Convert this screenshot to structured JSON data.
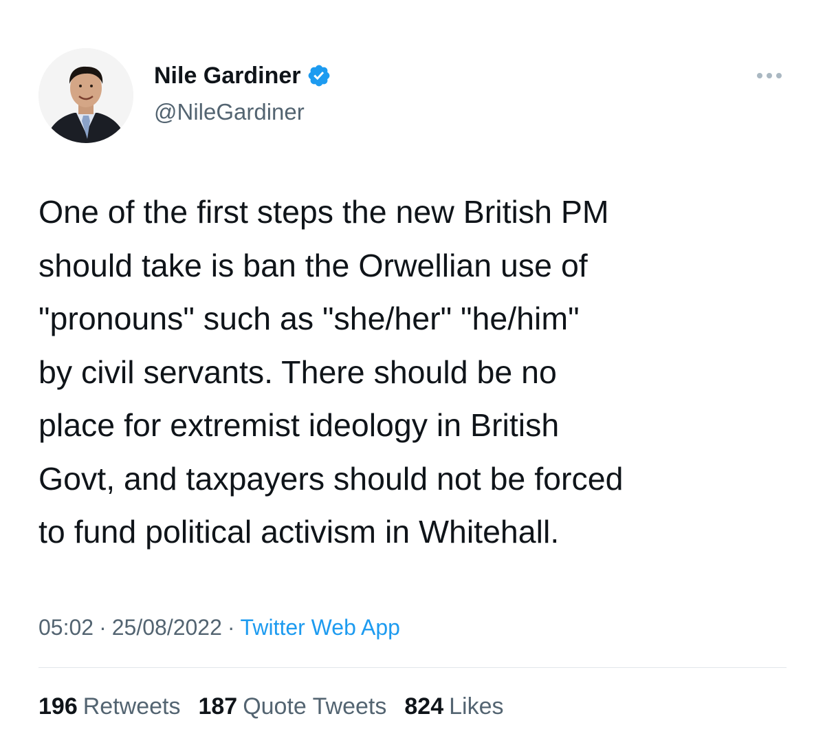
{
  "author": {
    "display_name": "Nile Gardiner",
    "handle": "@NileGardiner",
    "verified_icon": "verified-badge-icon",
    "avatar_icon": "profile-photo"
  },
  "menu": {
    "icon": "more-options-icon"
  },
  "tweet": {
    "text": "One of the first steps the new British PM\nshould take is ban the Orwellian use of\n\"pronouns\" such as \"she/her\" \"he/him\"\nby civil servants. There should be no\nplace for extremist ideology in British\nGovt, and taxpayers should not be forced\nto fund political activism in Whitehall.",
    "time": "05:02",
    "date": "25/08/2022",
    "separator": "·",
    "source": "Twitter Web App"
  },
  "stats": {
    "retweets_count": "196",
    "retweets_label": "Retweets",
    "quotes_count": "187",
    "quotes_label": "Quote Tweets",
    "likes_count": "824",
    "likes_label": "Likes"
  },
  "colors": {
    "text": "#0f1419",
    "secondary": "#536471",
    "accent": "#1d9bf0",
    "divider": "#e1e6ea"
  }
}
